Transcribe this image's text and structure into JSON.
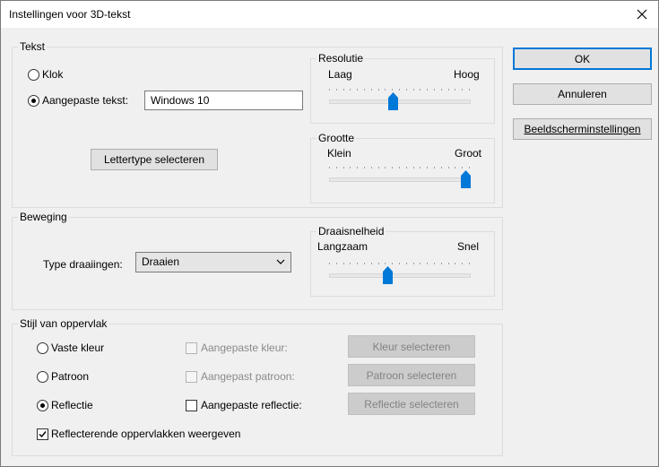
{
  "window": {
    "title": "Instellingen voor 3D-tekst"
  },
  "tekst": {
    "group_label": "Tekst",
    "clock_label": "Klok",
    "custom_label": "Aangepaste tekst:",
    "custom_value": "Windows 10",
    "font_button": "Lettertype selecteren",
    "resolution": {
      "label": "Resolutie",
      "min_label": "Laag",
      "max_label": "Hoog",
      "value_fraction": 0.45
    },
    "size": {
      "label": "Grootte",
      "min_label": "Klein",
      "max_label": "Groot",
      "value_fraction": 1.0
    }
  },
  "beweging": {
    "group_label": "Beweging",
    "type_label": "Type draaiingen:",
    "type_value": "Draaien",
    "speed": {
      "label": "Draaisnelheid",
      "min_label": "Langzaam",
      "max_label": "Snel",
      "value_fraction": 0.41
    }
  },
  "oppervlak": {
    "group_label": "Stijl van oppervlak",
    "solid_label": "Vaste kleur",
    "pattern_label": "Patroon",
    "reflection_label": "Reflectie",
    "custom_color_label": "Aangepaste kleur:",
    "custom_pattern_label": "Aangepast patroon:",
    "custom_reflection_label": "Aangepaste reflectie:",
    "color_button": "Kleur selecteren",
    "pattern_button": "Patroon selecteren",
    "reflection_button": "Reflectie selecteren",
    "show_reflective_label": "Reflecterende oppervlakken weergeven"
  },
  "buttons": {
    "ok": "OK",
    "cancel": "Annuleren",
    "display_settings": "Beeldscherminstellingen"
  },
  "colors": {
    "accent": "#0078d7"
  }
}
